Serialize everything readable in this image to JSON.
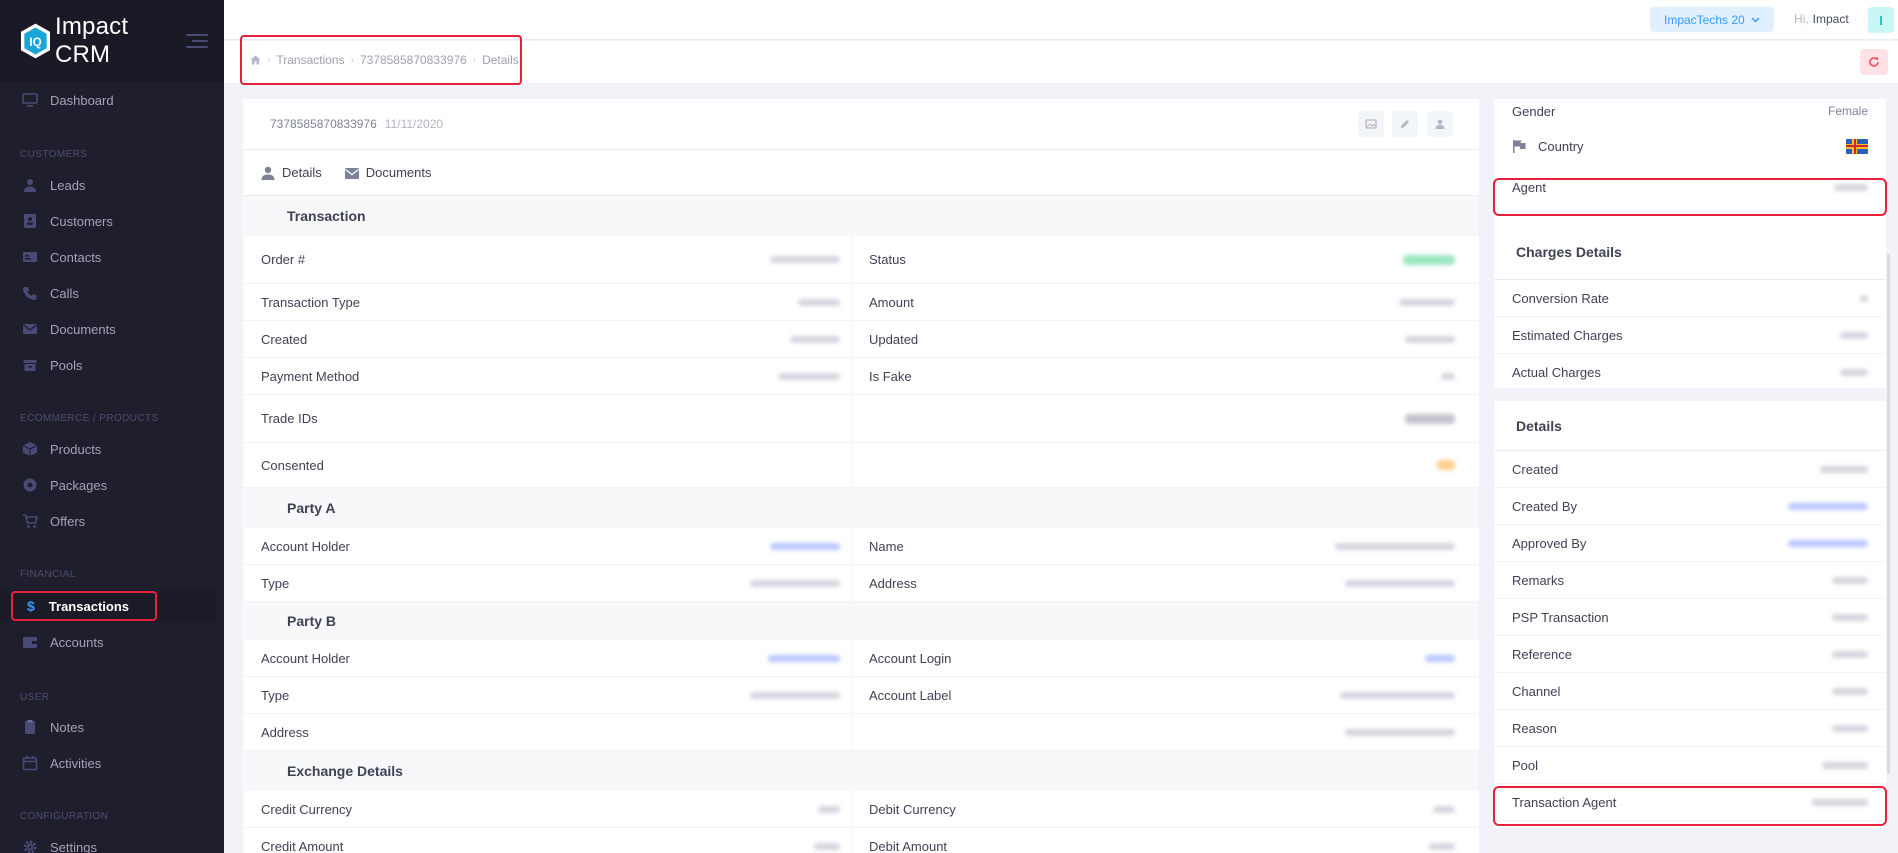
{
  "brand": {
    "name": "Impact CRM",
    "logo_text": "IQ"
  },
  "sidebar": {
    "dashboard": "Dashboard",
    "sections": {
      "customers": "CUSTOMERS",
      "ecommerce": "ECOMMERCE / PRODUCTS",
      "financial": "FINANCIAL",
      "user": "USER",
      "configuration": "CONFIGURATION"
    },
    "items": {
      "leads": "Leads",
      "customers": "Customers",
      "contacts": "Contacts",
      "calls": "Calls",
      "documents": "Documents",
      "pools": "Pools",
      "products": "Products",
      "packages": "Packages",
      "offers": "Offers",
      "transactions": "Transactions",
      "accounts": "Accounts",
      "notes": "Notes",
      "activities": "Activities",
      "settings": "Settings"
    },
    "active_symbol": "$"
  },
  "topbar": {
    "tenant": "ImpacTechs 20",
    "greeting": "Hi,",
    "user_name": "Impact",
    "user_initial": "I"
  },
  "breadcrumb": {
    "items": [
      "Transactions",
      "7378585870833976",
      "Details"
    ]
  },
  "transaction": {
    "id": "7378585870833976",
    "date": "11/11/2020"
  },
  "tabs": {
    "details": "Details",
    "documents": "Documents"
  },
  "sections": {
    "transaction": {
      "title": "Transaction",
      "rows": [
        {
          "left": "Order #",
          "right": "Status"
        },
        {
          "left": "Transaction Type",
          "right": "Amount"
        },
        {
          "left": "Created",
          "right": "Updated"
        },
        {
          "left": "Payment Method",
          "right": "Is Fake"
        },
        {
          "left": "Trade IDs",
          "right": ""
        },
        {
          "left": "Consented",
          "right": ""
        }
      ]
    },
    "party_a": {
      "title": "Party A",
      "rows": [
        {
          "left": "Account Holder",
          "right": "Name"
        },
        {
          "left": "Type",
          "right": "Address"
        }
      ]
    },
    "party_b": {
      "title": "Party B",
      "rows": [
        {
          "left": "Account Holder",
          "right": "Account Login"
        },
        {
          "left": "Type",
          "right": "Account Label"
        },
        {
          "left": "Address",
          "right": ""
        }
      ]
    },
    "exchange": {
      "title": "Exchange Details",
      "rows": [
        {
          "left": "Credit Currency",
          "right": "Debit Currency"
        },
        {
          "left": "Credit Amount",
          "right": "Debit Amount"
        }
      ]
    }
  },
  "right_panel": {
    "gender_label": "Gender",
    "gender_value": "Female",
    "country_label": "Country",
    "agent_label": "Agent",
    "charges_title": "Charges Details",
    "charges_rows": [
      "Conversion Rate",
      "Estimated Charges",
      "Actual Charges"
    ],
    "details_title": "Details",
    "details_rows": [
      "Created",
      "Created By",
      "Approved By",
      "Remarks",
      "PSP Transaction",
      "Reference",
      "Channel",
      "Reason",
      "Pool",
      "Transaction Agent"
    ]
  },
  "colors": {
    "sidebar_bg": "#1e1e2d",
    "accent": "#3699ff",
    "highlight": "#e5213c"
  }
}
